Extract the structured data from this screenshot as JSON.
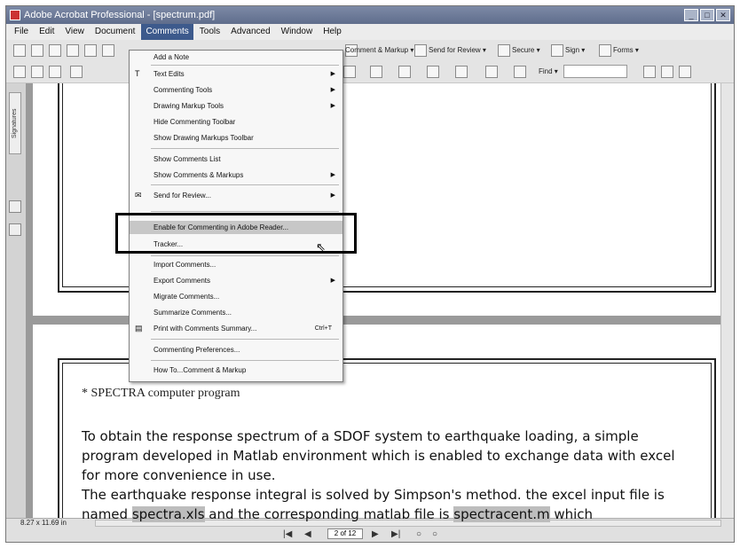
{
  "window": {
    "title": "Adobe Acrobat Professional - [spectrum.pdf]",
    "controls": [
      "_",
      "□",
      "✕"
    ]
  },
  "menubar": [
    "File",
    "Edit",
    "View",
    "Document",
    "Comments",
    "Tools",
    "Advanced",
    "Window",
    "Help"
  ],
  "toolbar": {
    "comment_markup": "Comment & Markup ▾",
    "send_for_review": "Send for Review ▾",
    "secure": "Secure ▾",
    "sign": "Sign ▾",
    "forms": "Forms ▾",
    "find": "Find ▾"
  },
  "left_panel": {
    "signatures_tab": "Signatures"
  },
  "comments_menu": {
    "items": [
      {
        "label": "Add a Note",
        "arrow": false
      },
      {
        "label": "Text Edits",
        "arrow": true
      },
      {
        "label": "Commenting Tools",
        "arrow": true
      },
      {
        "label": "Drawing Markup Tools",
        "arrow": true
      },
      {
        "label": "Hide Commenting Toolbar",
        "arrow": false
      },
      {
        "label": "Show Drawing Markups Toolbar",
        "arrow": false
      },
      {
        "label": "Show Comments List",
        "arrow": false
      },
      {
        "label": "Show Comments & Markups",
        "arrow": true
      },
      {
        "label": "Send for Review...",
        "arrow": true
      },
      {
        "label": "Enable for Commenting in Adobe Reader...",
        "arrow": false
      },
      {
        "label": "Tracker...",
        "arrow": false
      },
      {
        "label": "Import Comments...",
        "arrow": false
      },
      {
        "label": "Export Comments",
        "arrow": true
      },
      {
        "label": "Migrate Comments...",
        "arrow": false
      },
      {
        "label": "Summarize Comments...",
        "arrow": false
      },
      {
        "label": "Print with Comments Summary...",
        "arrow": false,
        "shortcut": "Ctrl+T"
      },
      {
        "label": "Commenting Preferences...",
        "arrow": false
      },
      {
        "label": "How To...Comment & Markup",
        "arrow": false
      }
    ]
  },
  "document": {
    "heading": "* SPECTRA computer program",
    "para1": "To obtain the response spectrum of a SDOF system to earthquake loading, a simple program developed in Matlab environment which is enabled to exchange data with excel for more convenience in use.",
    "para2_start": "The earthquake response integral is solved by Simpson's method. the excel input file is named ",
    "para2_file1": "spectra.xls",
    "para2_mid": " and the corresponding matlab file is ",
    "para2_file2": "spectracent.m",
    "para2_end": " which"
  },
  "status": {
    "page_size": "8.27 x 11.69 in",
    "page_indicator": "2 of 12",
    "nav": [
      "|◀",
      "◀",
      "▶",
      "▶|",
      "○",
      "○"
    ]
  }
}
